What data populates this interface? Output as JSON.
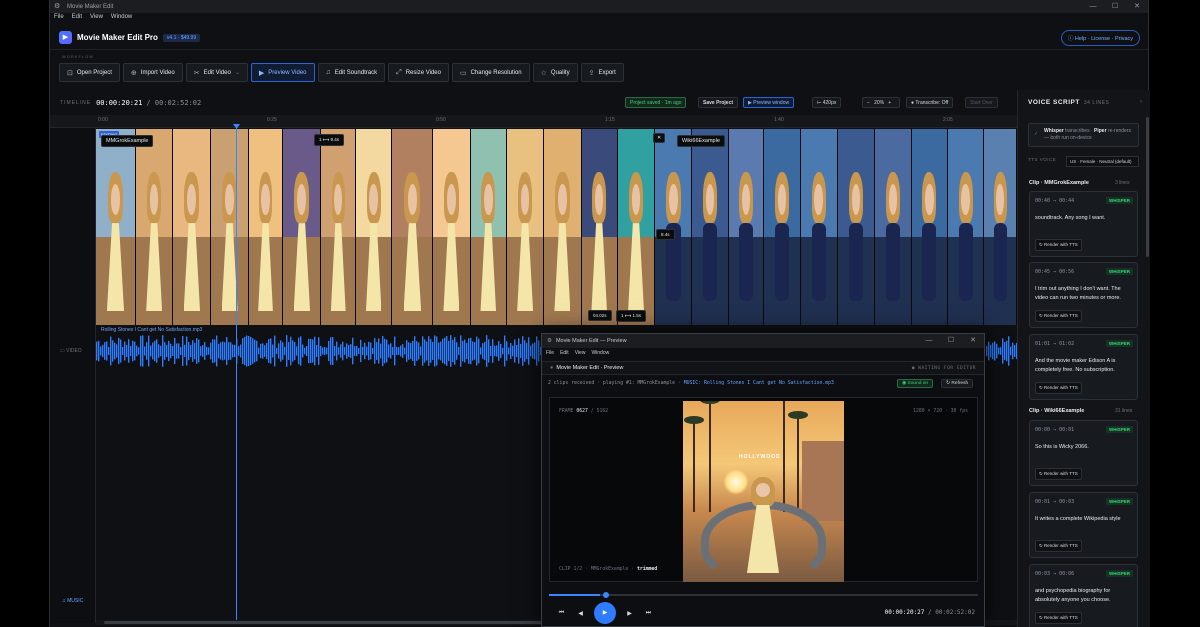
{
  "window": {
    "title": "Movie Maker Edit",
    "menu": [
      "File",
      "Edit",
      "View",
      "Window"
    ],
    "controls": [
      "—",
      "☐",
      "✕"
    ]
  },
  "app": {
    "title": "Movie Maker Edit Pro",
    "version": "v4.1 · $49.99",
    "links": "Help · License · Privacy",
    "workflow_label": "WORKFLOW"
  },
  "toolbar": [
    {
      "label": "Open Project",
      "icon": "open-icon",
      "glyph": "⊡"
    },
    {
      "label": "Import Video",
      "icon": "import-icon",
      "glyph": "⊕"
    },
    {
      "label": "Edit Video",
      "icon": "scissors-icon",
      "glyph": "✂"
    },
    {
      "label": "Preview Video",
      "icon": "play-icon",
      "glyph": "▶",
      "active": true
    },
    {
      "label": "Edit Soundtrack",
      "icon": "music-icon",
      "glyph": "♫"
    },
    {
      "label": "Resize Video",
      "icon": "resize-icon",
      "glyph": "⤢"
    },
    {
      "label": "Change Resolution",
      "icon": "monitor-icon",
      "glyph": "▭"
    },
    {
      "label": "Quality",
      "icon": "star-icon",
      "glyph": "☆"
    },
    {
      "label": "Export",
      "icon": "export-icon",
      "glyph": "⇪"
    }
  ],
  "timeline": {
    "label": "TIMELINE",
    "current": "00:00:20:21",
    "total": "/ 00:02:52:02",
    "saved": "Project saved · 1m ago",
    "save_button": "Save Project",
    "preview_window": "Preview window",
    "zoom": "420px",
    "zoom_pct": "20%",
    "transcribe": "Transcribe: Off",
    "start_over": "Start Over",
    "ruler": [
      "0:00",
      "0:25",
      "0:50",
      "1:15",
      "1:40",
      "2:05"
    ],
    "editing_badge": "EDITING",
    "clip1_label": "MMGrokExample",
    "clip2_label": "Wiki66Example",
    "clip_tag1": "1 ⟷ 9.4s",
    "clip_tag2": "8.4s",
    "clip_tag3": "04.02s",
    "clip_tag4": "1 ⟷ 1.5s",
    "close": "✕",
    "audio_label": "Rolling Stones I Cant get No Satisfaction.mp3",
    "video_track": "VIDEO",
    "music_track": "MUSIC"
  },
  "voice_script": {
    "title": "VOICE SCRIPT",
    "count": "34 LINES",
    "whisper_note_bold": "Whisper",
    "whisper_note": "transcribes ·",
    "piper_bold": "Piper",
    "whisper_note2": "re-renders — both run on-device",
    "tts_label": "TTS VOICE",
    "tts_value": "US · Female · Neutral (default)",
    "clips": [
      {
        "name": "Clip · MMGrokExample",
        "lines": "3 lines"
      },
      {
        "name": "Clip · Wiki66Example",
        "lines": "31 lines"
      }
    ],
    "entries": [
      {
        "time": "00:40 → 00:44",
        "text": "soundtrack. Any song I want."
      },
      {
        "time": "00:45 → 00:56",
        "text": "I trim out anything I don't want. The video can run two minutes or more."
      },
      {
        "time": "01:01 → 01:02",
        "text": "And the movie maker Edison A is completely free. No subscription."
      },
      {
        "time": "00:00 → 00:01",
        "text": "So this is Wicky 2066."
      },
      {
        "time": "00:01 → 00:03",
        "text": "It writes a complete Wikipedia style"
      },
      {
        "time": "00:03 → 00:06",
        "text": "and psychopedia biography for absolutely anyone you choose."
      }
    ],
    "badge": "WHISPER",
    "render_button": "↻ Render with TTS"
  },
  "preview": {
    "title": "Movie Maker Edit — Preview",
    "menu": [
      "File",
      "Edit",
      "View",
      "Window"
    ],
    "header": "Movie Maker Edit · Preview",
    "waiting": "● WAITING FOR EDITOR",
    "info": "2 clips received · playing #1: MMGrokExample · ",
    "music": "MUSIC: Rolling Stones I Cant get No Satisfaction.mp3",
    "sound_on": "◉ Sound on",
    "refresh": "↻ Refresh",
    "frame_label": "FRAME",
    "frame": "0627",
    "frame_total": "/ 5162",
    "resolution": "1280 × 720 · 30 fps",
    "clip_info": "CLIP 1/2 · MMGrokExample · ",
    "trimmed": "trimmed",
    "sign": "HOLLYWOOD",
    "current": "00:00:20:27",
    "total": "/ 00:02:52:02",
    "progress": 0.12
  },
  "colors": {
    "accent": "#3b86ff",
    "whisper": "#3ccf7a",
    "bg": "#0e1013"
  }
}
